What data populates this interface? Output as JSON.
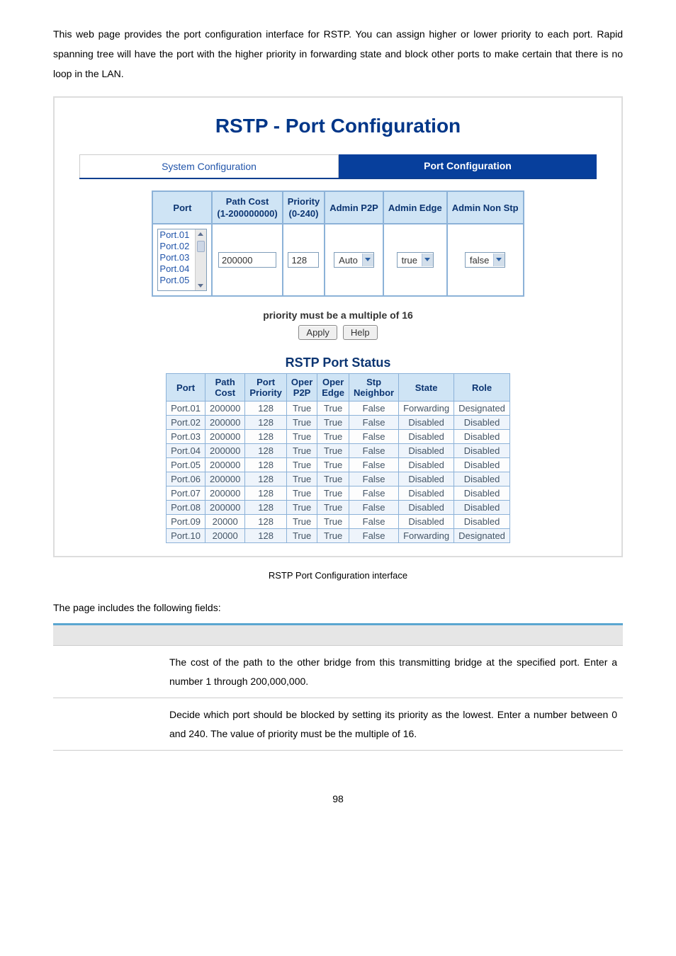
{
  "intro": "This web page provides the port configuration interface for RSTP. You can assign higher or lower priority to each port. Rapid spanning tree will have the port with the higher priority in forwarding state and block other ports to make certain that there is no loop in the LAN.",
  "panel": {
    "title": "RSTP - Port Configuration",
    "tab_inactive": "System Configuration",
    "tab_active": "Port Configuration",
    "cfg_headers": {
      "port": "Port",
      "path_cost": "Path Cost",
      "path_cost_sub": "(1-200000000)",
      "priority": "Priority",
      "priority_sub": "(0-240)",
      "admin_p2p": "Admin P2P",
      "admin_edge": "Admin Edge",
      "admin_non_stp": "Admin Non Stp"
    },
    "port_list": [
      "Port.01",
      "Port.02",
      "Port.03",
      "Port.04",
      "Port.05"
    ],
    "path_cost_value": "200000",
    "priority_value": "128",
    "admin_p2p_value": "Auto",
    "admin_edge_value": "true",
    "admin_non_stp_value": "false",
    "note": "priority must be a multiple of 16",
    "apply": "Apply",
    "help": "Help",
    "status_title": "RSTP Port Status",
    "status_headers": [
      "Port",
      "Path Cost",
      "Port Priority",
      "Oper P2P",
      "Oper Edge",
      "Stp Neighbor",
      "State",
      "Role"
    ],
    "status_rows": [
      [
        "Port.01",
        "200000",
        "128",
        "True",
        "True",
        "False",
        "Forwarding",
        "Designated"
      ],
      [
        "Port.02",
        "200000",
        "128",
        "True",
        "True",
        "False",
        "Disabled",
        "Disabled"
      ],
      [
        "Port.03",
        "200000",
        "128",
        "True",
        "True",
        "False",
        "Disabled",
        "Disabled"
      ],
      [
        "Port.04",
        "200000",
        "128",
        "True",
        "True",
        "False",
        "Disabled",
        "Disabled"
      ],
      [
        "Port.05",
        "200000",
        "128",
        "True",
        "True",
        "False",
        "Disabled",
        "Disabled"
      ],
      [
        "Port.06",
        "200000",
        "128",
        "True",
        "True",
        "False",
        "Disabled",
        "Disabled"
      ],
      [
        "Port.07",
        "200000",
        "128",
        "True",
        "True",
        "False",
        "Disabled",
        "Disabled"
      ],
      [
        "Port.08",
        "200000",
        "128",
        "True",
        "True",
        "False",
        "Disabled",
        "Disabled"
      ],
      [
        "Port.09",
        "20000",
        "128",
        "True",
        "True",
        "False",
        "Disabled",
        "Disabled"
      ],
      [
        "Port.10",
        "20000",
        "128",
        "True",
        "True",
        "False",
        "Forwarding",
        "Designated"
      ]
    ]
  },
  "caption": "RSTP Port Configuration interface",
  "fields_intro": "The page includes the following fields:",
  "fields": [
    {
      "desc": "The cost of the path to the other bridge from this transmitting bridge at the specified port. Enter a number 1 through 200,000,000."
    },
    {
      "desc": "Decide which port should be blocked by setting its priority as the lowest. Enter a number between 0 and 240. The value of priority must be the multiple of 16."
    }
  ],
  "pagenum": "98"
}
